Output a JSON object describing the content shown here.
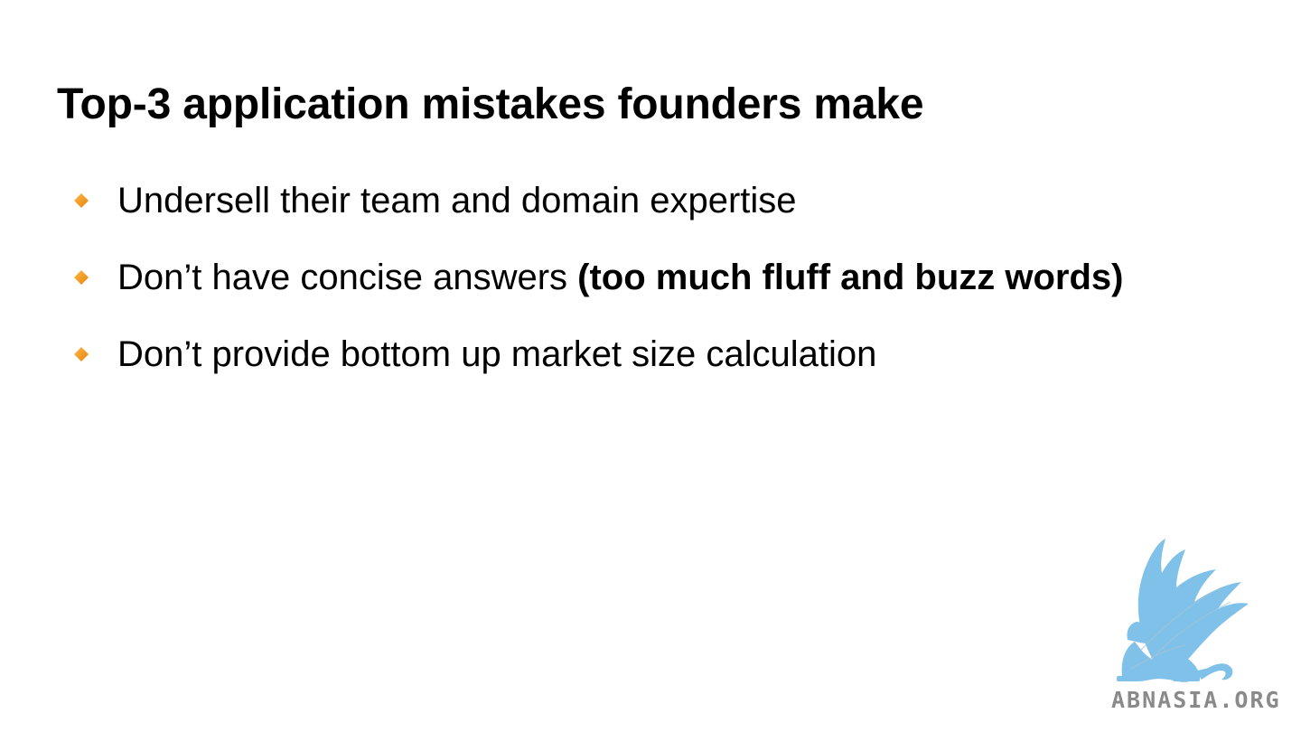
{
  "slide": {
    "title": "Top-3 application mistakes founders make",
    "bullets": [
      {
        "text": "Undersell their team and domain expertise",
        "bold": ""
      },
      {
        "text": "Don’t have concise answers ",
        "bold": "(too much fluff and buzz words)"
      },
      {
        "text": "Don’t provide bottom up market size calculation",
        "bold": ""
      }
    ],
    "bullet_icon": "diamond-bullet-icon",
    "bullet_color": "#F39200"
  },
  "watermark": {
    "logo_icon": "griffin-logo-icon",
    "logo_color": "#7FC1E8",
    "text": "ABNASIA.ORG"
  }
}
